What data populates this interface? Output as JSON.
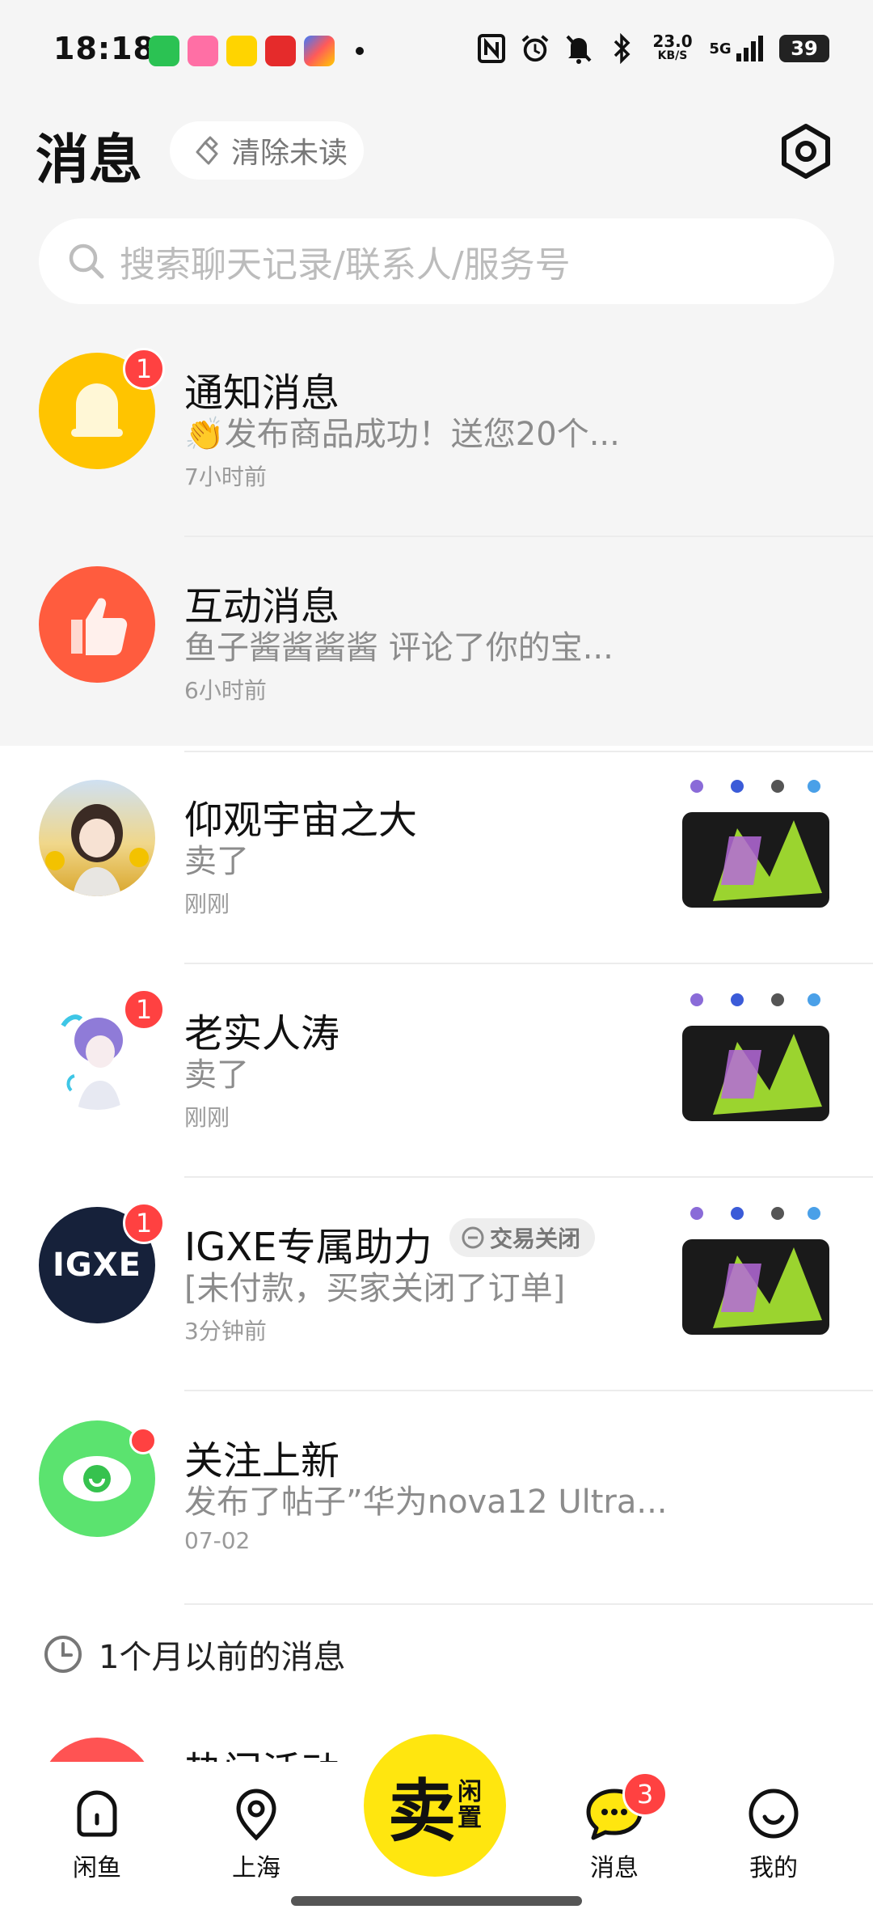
{
  "status_bar": {
    "time": "18:18",
    "net_speed_value": "23.0",
    "net_speed_unit": "KB/S",
    "network": "5G",
    "battery": "39"
  },
  "header": {
    "title": "消息",
    "clear_label": "清除未读"
  },
  "search": {
    "placeholder": "搜索聊天记录/联系人/服务号"
  },
  "rows": [
    {
      "title": "通知消息",
      "subtitle": "👏发布商品成功！送您20个...",
      "time": "7小时前",
      "badge": "1"
    },
    {
      "title": "互动消息",
      "subtitle": "鱼子酱酱酱酱 评论了你的宝...",
      "time": "6小时前"
    },
    {
      "title": "仰观宇宙之大",
      "subtitle": "卖了",
      "time": "刚刚"
    },
    {
      "title": "老实人涛",
      "subtitle": "卖了",
      "time": "刚刚",
      "badge": "1"
    },
    {
      "title": "IGXE专属助力",
      "tag": "交易关闭",
      "subtitle": "[未付款，买家关闭了订单]",
      "time": "3分钟前",
      "badge": "1",
      "avatar_text": "IGXE"
    },
    {
      "title": "关注上新",
      "subtitle": "发布了帖子”华为nova12 Ultra...",
      "time": "07-02"
    }
  ],
  "section_label": "1个月以前的消息",
  "partial_row_title": "热门活动",
  "tabbar": {
    "home": "闲鱼",
    "location": "上海",
    "sell_big": "卖",
    "sell_small_1": "闲",
    "sell_small_2": "置",
    "messages": "消息",
    "messages_badge": "3",
    "mine": "我的"
  },
  "colors": {
    "accent_yellow": "#ffe60f",
    "badge_red": "#ff4141",
    "notify_yellow": "#ffc400",
    "interact_orange": "#ff5c3e",
    "follow_green": "#5be36f"
  }
}
